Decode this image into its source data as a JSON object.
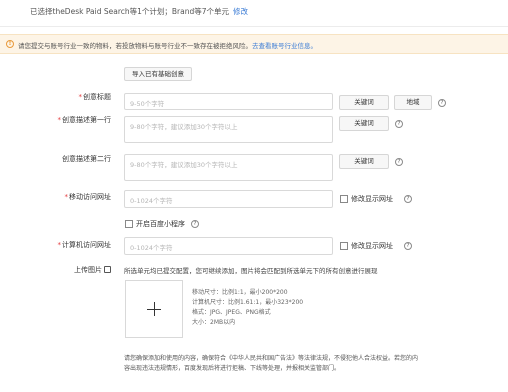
{
  "selection": {
    "text": "已选择theDesk Paid Search等1个计划；Brand等7个单元",
    "modify_link": "修改"
  },
  "notice": {
    "text": "请您提交与账号行业一致的物料，若投放物料与账号行业不一致存在被拒绝风险。",
    "link": "去查看账号行业信息。",
    "icon": "warning-icon"
  },
  "import_button": "导入已有基础创意",
  "fields": {
    "title": {
      "label": "创意标题",
      "placeholder": "9-50个字符",
      "keyword_btn": "关键词",
      "region_btn": "地域"
    },
    "desc1": {
      "label": "创意描述第一行",
      "placeholder": "9-80个字符，建议添加30个字符以上",
      "keyword_btn": "关键词"
    },
    "desc2": {
      "label": "创意描述第二行",
      "placeholder": "9-80个字符，建议添加30个字符以上",
      "keyword_btn": "关键词"
    },
    "mobile_url": {
      "label": "移动访问网址",
      "placeholder": "0-1024个字符",
      "checkbox_label": "修改显示网址"
    },
    "mini_program": {
      "checkbox_label": "开启百度小程序"
    },
    "pc_url": {
      "label": "计算机访问网址",
      "placeholder": "0-1024个字符",
      "checkbox_label": "修改显示网址"
    }
  },
  "upload": {
    "label": "上传图片",
    "hint": "所选单元均已提交配置，您可继续添加，图片将会匹配到所选单元下的所有创意进行展现",
    "specs": [
      "移动尺寸：比例1:1，最小200*200",
      "计算机尺寸：比例1.61:1，最小323*200",
      "格式：JPG、JPEG、PNG格式",
      "大小：2MB以内"
    ]
  },
  "footer": {
    "line1": "请您确保添加和使用的内容，确保符合《中华人民共和国广告法》等法律法规，不侵犯他人合法权益。若您的内",
    "line2": "容出现违法违规情形，百度发现后将进行拒稿、下线等处理，并报相关监管部门。"
  },
  "colors": {
    "link": "#3a7bd5",
    "required": "#e4393c",
    "notice_bg": "#fdf4e6"
  }
}
